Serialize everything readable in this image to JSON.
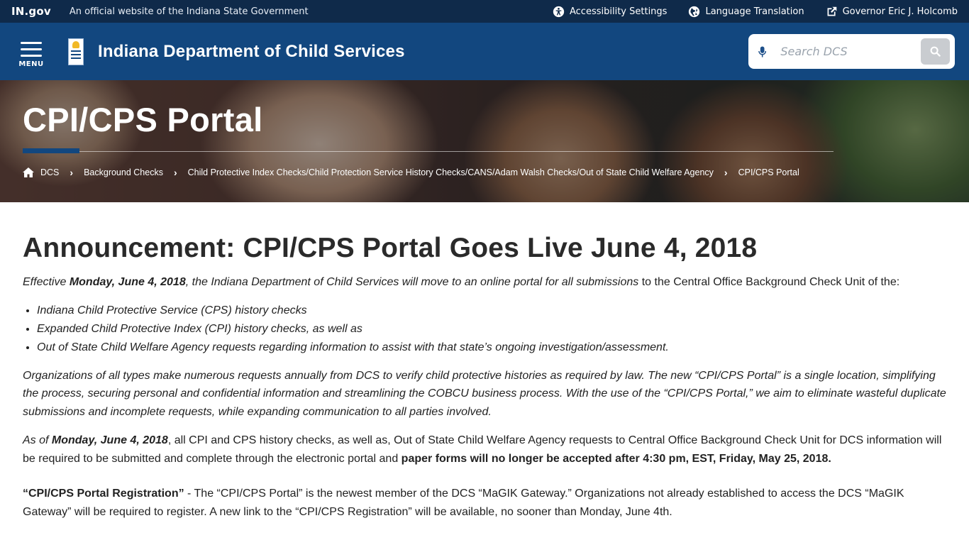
{
  "topbar": {
    "logo_text": "IN.gov",
    "official_text": "An official website of the Indiana State Government",
    "links": [
      {
        "label": "Accessibility Settings",
        "icon": "accessibility-icon"
      },
      {
        "label": "Language Translation",
        "icon": "globe-icon"
      },
      {
        "label": "Governor Eric J. Holcomb",
        "icon": "external-link-icon"
      }
    ]
  },
  "header": {
    "menu_label": "MENU",
    "agency_name": "Indiana Department of Child Services",
    "search_placeholder": "Search DCS"
  },
  "hero": {
    "title": "CPI/CPS Portal",
    "breadcrumbs": [
      "DCS",
      "Background Checks",
      "Child Protective Index Checks/Child Protection Service History Checks/CANS/Adam Walsh Checks/Out of State Child Welfare Agency",
      "CPI/CPS Portal"
    ]
  },
  "content": {
    "heading": "Announcement: CPI/CPS Portal Goes Live June 4, 2018",
    "intro": {
      "p1": "Effective ",
      "p2": "Monday, June 4, 2018",
      "p3": ", the Indiana Department of Child Services will move to an online portal for all submissions",
      "p4": " to the Central Office Background Check Unit of the:"
    },
    "bullets": [
      "Indiana Child Protective Service (CPS) history checks",
      "Expanded Child Protective Index (CPI) history checks, as well as",
      "Out of State Child Welfare Agency requests regarding information to assist with that state’s ongoing investigation/assessment."
    ],
    "para2": "Organizations of all types make numerous requests annually from DCS to verify child protective histories as required by law. The new “CPI/CPS Portal” is a single location, simplifying the process, securing personal and confidential information and streamlining the COBCU business process. With the use of the “CPI/CPS Portal,” we aim to eliminate wasteful duplicate submissions and incomplete requests, while expanding communication to all parties involved.",
    "para3": {
      "p1": "As of ",
      "p2": "Monday, June 4, 2018",
      "p3": ", all CPI and CPS history checks, as well as, Out of State Child Welfare Agency requests to Central Office Background Check Unit for DCS information will be required to be submitted and complete through the electronic portal and ",
      "p4": "paper forms will no longer be accepted after 4:30 pm, EST, Friday, May 25, 2018."
    },
    "para4": {
      "p1": "“CPI/CPS Portal Registration”",
      "p2": " - The “CPI/CPS Portal” is the newest member of the DCS “MaGIK Gateway.”  Organizations not already established to access the DCS “MaGIK Gateway” will be required to register. A new link to the “CPI/CPS Registration” will be available, no sooner than Monday, June 4th."
    }
  },
  "colors": {
    "topbar_bg": "#0f2a4a",
    "header_bg": "#12477f",
    "accent": "#12477f"
  }
}
